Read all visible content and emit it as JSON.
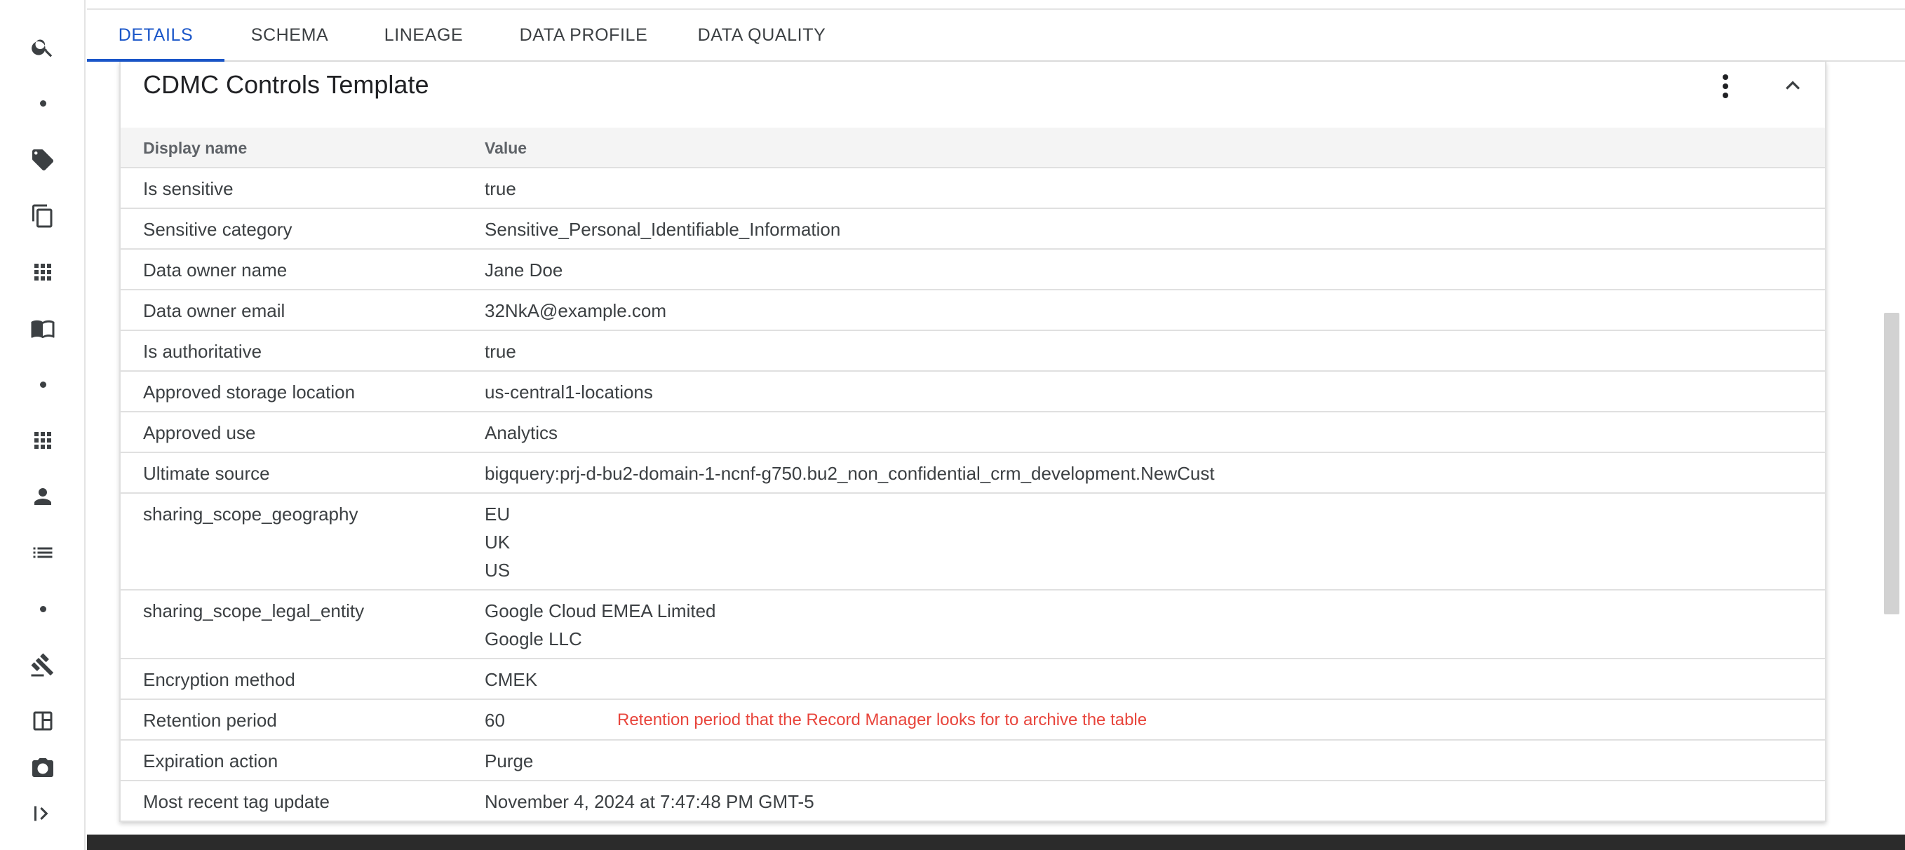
{
  "rail": {
    "items": [
      {
        "icon": "search-icon"
      },
      {
        "icon": "dot"
      },
      {
        "icon": "tag-icon"
      },
      {
        "icon": "copy-icon"
      },
      {
        "icon": "grid-icon"
      },
      {
        "icon": "book-icon"
      },
      {
        "icon": "dot"
      },
      {
        "icon": "grid-icon"
      },
      {
        "icon": "person-icon"
      },
      {
        "icon": "list-icon"
      },
      {
        "icon": "dot"
      },
      {
        "icon": "gavel-icon"
      },
      {
        "icon": "dashboard-icon"
      },
      {
        "icon": "camera-icon"
      },
      {
        "icon": "expand-rail-icon"
      }
    ]
  },
  "tabs": [
    {
      "label": "DETAILS",
      "active": true
    },
    {
      "label": "SCHEMA",
      "active": false
    },
    {
      "label": "LINEAGE",
      "active": false
    },
    {
      "label": "DATA PROFILE",
      "active": false
    },
    {
      "label": "DATA QUALITY",
      "active": false
    }
  ],
  "card": {
    "title": "CDMC Controls Template",
    "columns": {
      "name": "Display name",
      "value": "Value"
    },
    "rows": [
      {
        "name": "Is sensitive",
        "values": [
          "true"
        ]
      },
      {
        "name": "Sensitive category",
        "values": [
          "Sensitive_Personal_Identifiable_Information"
        ]
      },
      {
        "name": "Data owner name",
        "values": [
          "Jane Doe"
        ]
      },
      {
        "name": "Data owner email",
        "values": [
          "32NkA@example.com"
        ]
      },
      {
        "name": "Is authoritative",
        "values": [
          "true"
        ]
      },
      {
        "name": "Approved storage location",
        "values": [
          "us-central1-locations"
        ]
      },
      {
        "name": "Approved use",
        "values": [
          "Analytics"
        ]
      },
      {
        "name": "Ultimate source",
        "values": [
          "bigquery:prj-d-bu2-domain-1-ncnf-g750.bu2_non_confidential_crm_development.NewCust"
        ]
      },
      {
        "name": "sharing_scope_geography",
        "values": [
          "EU",
          "UK",
          "US"
        ]
      },
      {
        "name": "sharing_scope_legal_entity",
        "values": [
          "Google Cloud EMEA Limited",
          "Google LLC"
        ]
      },
      {
        "name": "Encryption method",
        "values": [
          "CMEK"
        ]
      },
      {
        "name": "Retention period",
        "values": [
          "60"
        ],
        "annotation": "Retention period that the Record Manager looks for to archive the table"
      },
      {
        "name": "Expiration action",
        "values": [
          "Purge"
        ]
      },
      {
        "name": "Most recent tag update",
        "values": [
          "November 4, 2024 at 7:47:48 PM GMT-5"
        ]
      }
    ]
  },
  "colors": {
    "accent": "#1a56c9",
    "annotation": "#e8453c"
  }
}
